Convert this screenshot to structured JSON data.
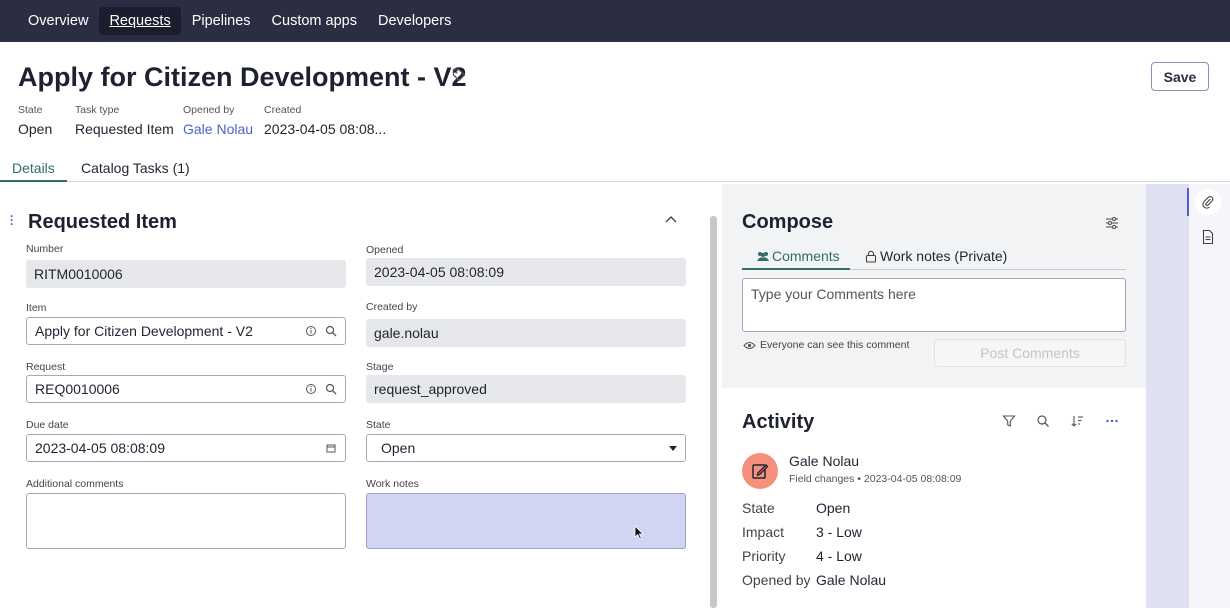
{
  "nav": {
    "items": [
      {
        "label": "Overview"
      },
      {
        "label": "Requests"
      },
      {
        "label": "Pipelines"
      },
      {
        "label": "Custom apps"
      },
      {
        "label": "Developers"
      }
    ],
    "active_index": 1
  },
  "header": {
    "title": "Apply for Citizen Development - V2",
    "save_label": "Save",
    "meta": [
      {
        "label": "State",
        "value": "Open"
      },
      {
        "label": "Task type",
        "value": "Requested Item"
      },
      {
        "label": "Opened by",
        "value": "Gale Nolau"
      },
      {
        "label": "Created",
        "value": "2023-04-05 08:08..."
      }
    ]
  },
  "tabs": [
    {
      "label": "Details"
    },
    {
      "label": "Catalog Tasks (1)"
    }
  ],
  "form": {
    "title": "Requested Item",
    "number": {
      "label": "Number",
      "value": "RITM0010006"
    },
    "opened": {
      "label": "Opened",
      "value": "2023-04-05 08:08:09"
    },
    "item": {
      "label": "Item",
      "value": "Apply for Citizen Development - V2"
    },
    "created_by": {
      "label": "Created by",
      "value": "gale.nolau"
    },
    "request": {
      "label": "Request",
      "value": "REQ0010006"
    },
    "stage": {
      "label": "Stage",
      "value": "request_approved"
    },
    "due_date": {
      "label": "Due date",
      "value": "2023-04-05 08:08:09"
    },
    "state": {
      "label": "State",
      "value": "Open"
    },
    "additional_comments": {
      "label": "Additional comments",
      "value": ""
    },
    "work_notes": {
      "label": "Work notes",
      "value": ""
    }
  },
  "compose": {
    "title": "Compose",
    "tabs": [
      {
        "label": "Comments"
      },
      {
        "label": "Work notes (Private)"
      }
    ],
    "placeholder": "Type your Comments here",
    "visibility_note": "Everyone can see this comment",
    "post_label": "Post Comments"
  },
  "activity": {
    "title": "Activity",
    "entry": {
      "name": "Gale Nolau",
      "subtitle": "Field changes • 2023-04-05 08:08:09",
      "fields": [
        {
          "key": "State",
          "value": "Open"
        },
        {
          "key": "Impact",
          "value": "3 - Low"
        },
        {
          "key": "Priority",
          "value": "4 - Low"
        },
        {
          "key": "Opened by",
          "value": "Gale Nolau"
        }
      ]
    }
  },
  "colors": {
    "nav_bg": "#2b2d42",
    "accent_teal": "#2f6e6a",
    "link_blue": "#4a62c9",
    "avatar_bg": "#f4907b"
  },
  "icons": [
    "tag-icon",
    "chevron-up-icon",
    "info-icon",
    "search-icon",
    "calendar-icon",
    "caret-down-icon",
    "settings-sliders-icon",
    "people-icon",
    "lock-icon",
    "eye-icon",
    "filter-icon",
    "sort-icon",
    "more-icon",
    "edit-icon",
    "paperclip-icon",
    "document-icon"
  ]
}
